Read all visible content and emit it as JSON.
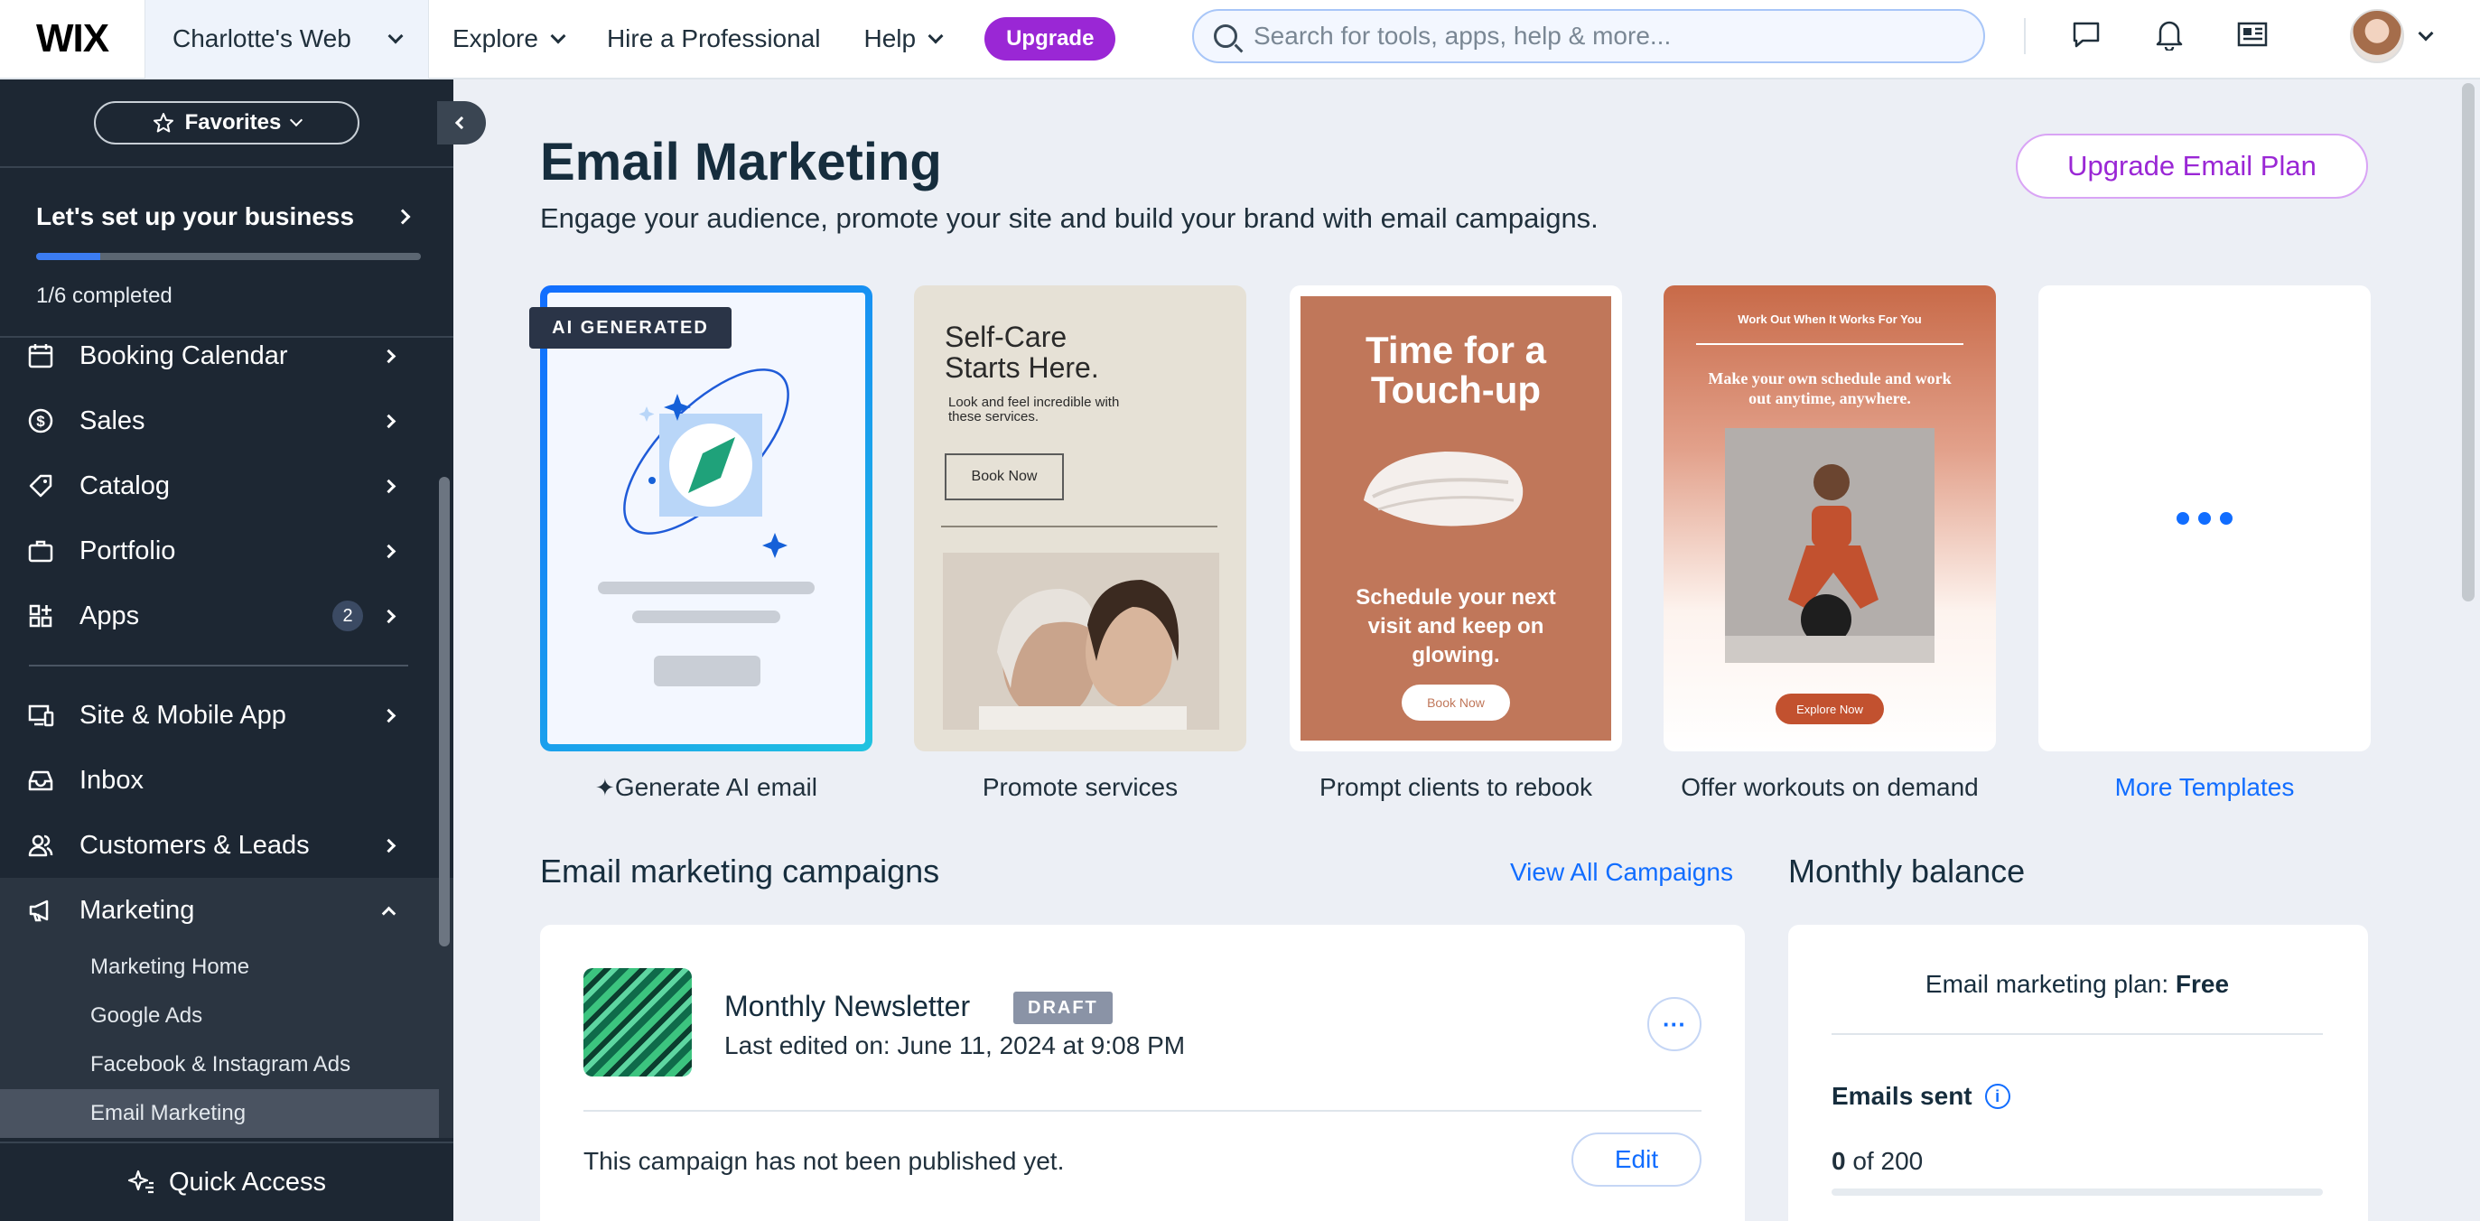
{
  "topbar": {
    "logo": "WIX",
    "site_name": "Charlotte's Web",
    "nav": [
      {
        "label": "Explore",
        "has_dropdown": true
      },
      {
        "label": "Hire a Professional",
        "has_dropdown": false
      },
      {
        "label": "Help",
        "has_dropdown": true
      }
    ],
    "upgrade_label": "Upgrade",
    "search_placeholder": "Search for tools, apps, help & more...",
    "icons": [
      "chat-icon",
      "bell-icon",
      "newspaper-icon"
    ]
  },
  "sidebar": {
    "favorites_label": "Favorites",
    "setup": {
      "title": "Let's set up your business",
      "progress": "1/6 completed",
      "progress_fraction": 0.167
    },
    "items": [
      {
        "label": "Booking Calendar",
        "icon": "calendar-icon",
        "has_arrow": true
      },
      {
        "label": "Sales",
        "icon": "dollar-icon",
        "has_arrow": true
      },
      {
        "label": "Catalog",
        "icon": "tag-icon",
        "has_arrow": true
      },
      {
        "label": "Portfolio",
        "icon": "briefcase-icon",
        "has_arrow": true
      },
      {
        "label": "Apps",
        "icon": "apps-icon",
        "has_arrow": true,
        "badge": "2"
      }
    ],
    "items2": [
      {
        "label": "Site & Mobile App",
        "icon": "devices-icon",
        "has_arrow": true
      },
      {
        "label": "Inbox",
        "icon": "inbox-icon",
        "has_arrow": false
      },
      {
        "label": "Customers & Leads",
        "icon": "people-icon",
        "has_arrow": true
      }
    ],
    "marketing": {
      "label": "Marketing",
      "icon": "megaphone-icon",
      "subitems": [
        "Marketing Home",
        "Google Ads",
        "Facebook & Instagram Ads",
        "Email Marketing"
      ],
      "active": "Email Marketing"
    },
    "quick_access": "Quick Access"
  },
  "main": {
    "title": "Email Marketing",
    "subtitle": "Engage your audience, promote your site and build your brand with email campaigns.",
    "upgrade_plan": "Upgrade Email Plan",
    "templates": {
      "ai_tag": "AI GENERATED",
      "labels": [
        "Generate AI email",
        "Promote services",
        "Prompt clients to rebook",
        "Offer workouts on demand",
        "More Templates"
      ],
      "self_care": {
        "title": "Self-Care Starts Here.",
        "body": "Look and feel incredible with these services.",
        "button": "Book Now"
      },
      "touch_up": {
        "title": "Time for a Touch-up",
        "body": "Schedule your next visit and keep on glowing.",
        "button": "Book Now"
      },
      "workout": {
        "header": "Work Out When It Works For You",
        "body": "Make your own schedule and work out anytime, anywhere.",
        "button": "Explore Now"
      }
    },
    "campaigns": {
      "title": "Email marketing campaigns",
      "view_all": "View All Campaigns",
      "item": {
        "name": "Monthly Newsletter",
        "status": "DRAFT",
        "edited": "Last edited on: June 11, 2024 at 9:08 PM",
        "more": "···",
        "note": "This campaign has not been published yet.",
        "edit": "Edit"
      }
    },
    "balance": {
      "title": "Monthly balance",
      "plan_prefix": "Email marketing plan:",
      "plan_name": "Free",
      "emails_sent_label": "Emails sent",
      "sent_value": "0",
      "sent_suffix": "of 200",
      "sent_fraction": 0
    }
  }
}
